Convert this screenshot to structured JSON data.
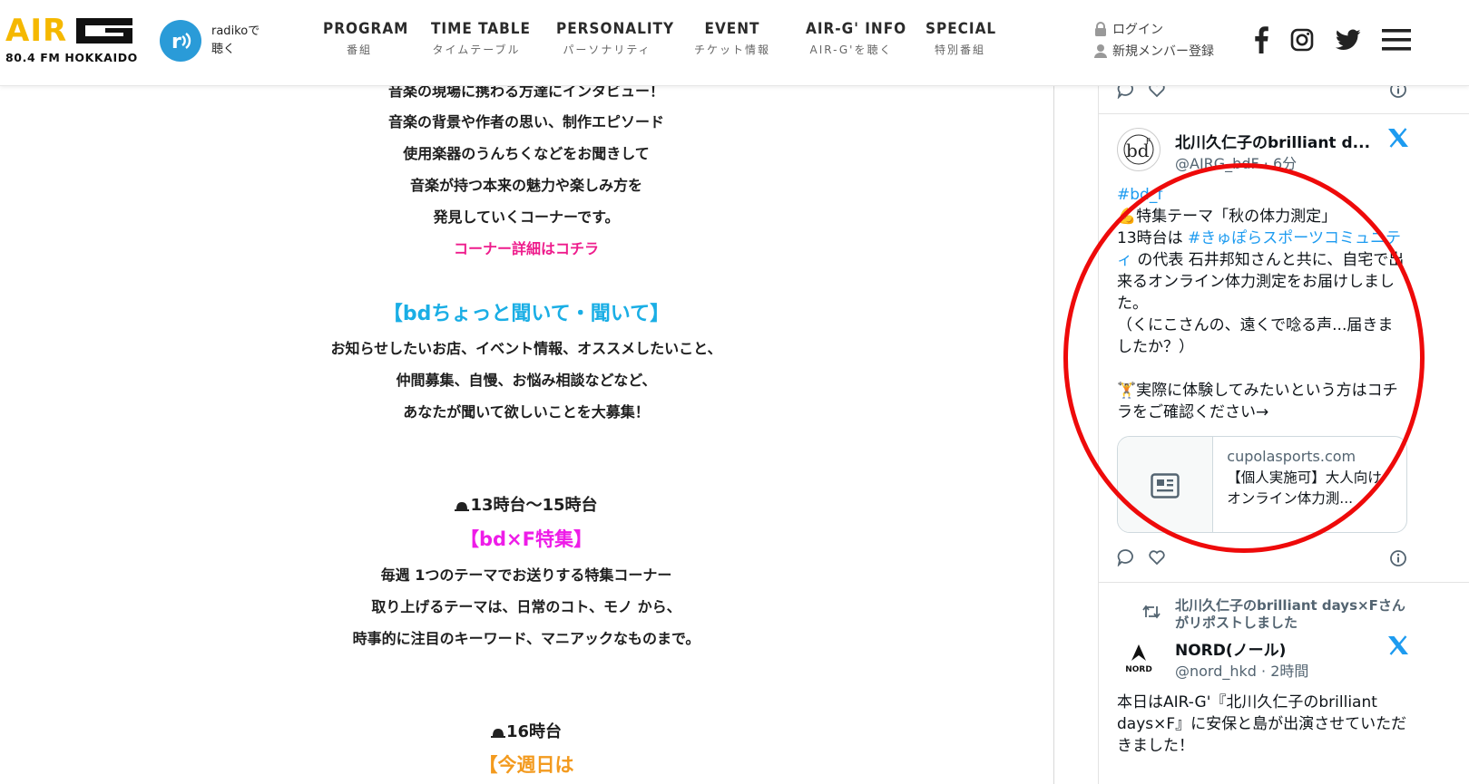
{
  "header": {
    "logo_text": "AIR",
    "logo_sub": "80.4 FM HOKKAIDO",
    "radiko": {
      "line1": "radikoで",
      "line2": "聴く"
    },
    "nav": [
      {
        "main": "PROGRAM",
        "sub": "番組"
      },
      {
        "main": "TIME TABLE",
        "sub": "タイムテーブル"
      },
      {
        "main": "PERSONALITY",
        "sub": "パーソナリティ"
      },
      {
        "main": "EVENT",
        "sub": "チケット情報"
      },
      {
        "main": "AIR-G' INFO",
        "sub": "AIR-G'を聴く"
      },
      {
        "main": "SPECIAL",
        "sub": "特別番組"
      }
    ],
    "login": "ログイン",
    "register": "新規メンバー登録",
    "brand_color": "#f5b800"
  },
  "main": {
    "cut_top_line": "音楽の現場に携わる方達にインタビュー！",
    "intro_lines": [
      "音楽の背景や作者の思い、制作エピソード",
      "使用楽器のうんちくなどをお聞きして",
      "音楽が持つ本来の魅力や楽しみ方を",
      "発見していくコーナーです。"
    ],
    "corner_link": "コーナー詳細はコチラ",
    "section1_title": "【bdちょっと聞いて・聞いて】",
    "section1_lines": [
      "お知らせしたいお店、イベント情報、オススメしたいこと、",
      "仲間募集、自慢、お悩み相談などなど、",
      "あなたが聞いて欲しいことを大募集！"
    ],
    "time1": "13時台〜15時台",
    "section2_title": "【bd×F特集】",
    "section2_lines": [
      "毎週 1つのテーマでお送りする特集コーナー",
      "取り上げるテーマは、日常のコト、モノ から、",
      "時事的に注目のキーワード、マニアックなものまで。"
    ],
    "time2": "16時台",
    "section3_title_cut": "【今週日は"
  },
  "tweets": {
    "tweet1": {
      "name": "北川久仁子のbrilliant d...",
      "handle": "@AIRG_bdF · 6分",
      "hashtag": "#bd_f",
      "line_theme": "特集テーマ「秋の体力測定」",
      "body_prefix": "13時台は ",
      "body_link": "#きゅぽらスポーツコミュニティ",
      "body_rest": " の代表 石井邦知さんと共に、自宅で出来るオンライン体力測定をお届けしました。",
      "body_paren": "（くにこさんの、遠くで唸る声...届きましたか？）",
      "body_cta": "実際に体験してみたいという方はコチラをご確認ください→",
      "card_domain": "cupolasports.com",
      "card_title": "【個人実施可】大人向け オンライン体力測..."
    },
    "tweet2": {
      "repost_note": "北川久仁子のbrilliant days×Fさんがリポストしました",
      "name": "NORD(ノール)",
      "handle": "@nord_hkd · 2時間",
      "avatar_label": "NORD",
      "body": "本日はAIR-G'『北川久仁子のbrilliant days×F』に安保と島が出演させていただきました！"
    },
    "link_color": "#1d9bf0"
  },
  "annotation_color": "#ee0a0a"
}
